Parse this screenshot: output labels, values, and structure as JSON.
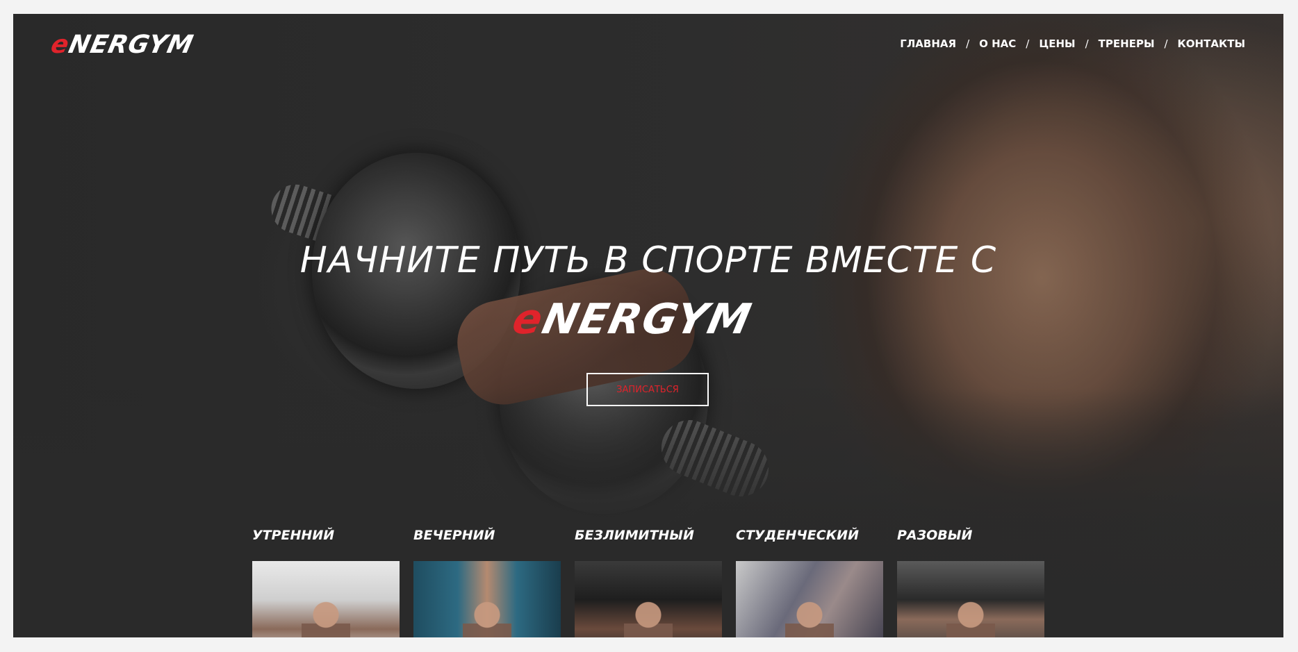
{
  "brand": {
    "logo_e": "e",
    "logo_rest": "NERGYM",
    "accent": "#e0232b"
  },
  "nav": {
    "items": [
      {
        "label": "ГЛАВНАЯ"
      },
      {
        "label": "О НАС"
      },
      {
        "label": "ЦЕНЫ"
      },
      {
        "label": "ТРЕНЕРЫ"
      },
      {
        "label": "КОНТАКТЫ"
      }
    ],
    "separator": "/"
  },
  "hero": {
    "headline": "НАЧНИТЕ ПУТЬ В СПОРТЕ ВМЕСТЕ С",
    "cta_label": "ЗАПИСАТЬСЯ"
  },
  "plans": [
    {
      "title": "УТРЕННИЙ"
    },
    {
      "title": "ВЕЧЕРНИЙ"
    },
    {
      "title": "БЕЗЛИМИТНЫЙ"
    },
    {
      "title": "СТУДЕНЧЕСКИЙ"
    },
    {
      "title": "РАЗОВЫЙ"
    }
  ]
}
